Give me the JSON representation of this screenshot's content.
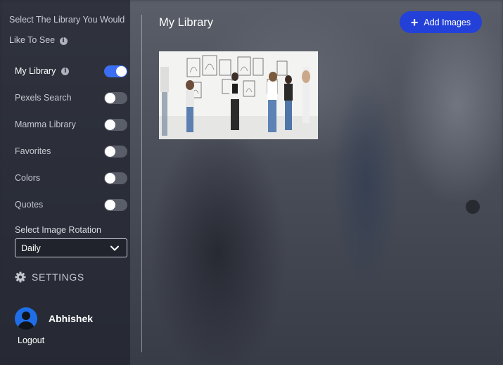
{
  "sidebar": {
    "intro_text": "Select The Library You Would Like To See",
    "toggles": [
      {
        "label": "My Library",
        "on": true,
        "has_info": true
      },
      {
        "label": "Pexels Search",
        "on": false
      },
      {
        "label": "Mamma Library",
        "on": false
      },
      {
        "label": "Favorites",
        "on": false
      },
      {
        "label": "Colors",
        "on": false
      },
      {
        "label": "Quotes",
        "on": false
      }
    ],
    "rotation_label": "Select Image Rotation",
    "rotation_value": "Daily",
    "settings_label": "SETTINGS",
    "user_name": "Abhishek",
    "logout_label": "Logout"
  },
  "main": {
    "title": "My Library",
    "add_button_label": "Add Images",
    "images": [
      {
        "subject": "people viewing artwork in a white gallery"
      }
    ]
  },
  "colors": {
    "accent_toggle": "#3b6ef2",
    "add_button": "#2341d8",
    "avatar": "#1f6ee8"
  },
  "icons": [
    "info-icon",
    "chevron-down-icon",
    "gear-icon",
    "plus-icon",
    "user-avatar-icon"
  ]
}
